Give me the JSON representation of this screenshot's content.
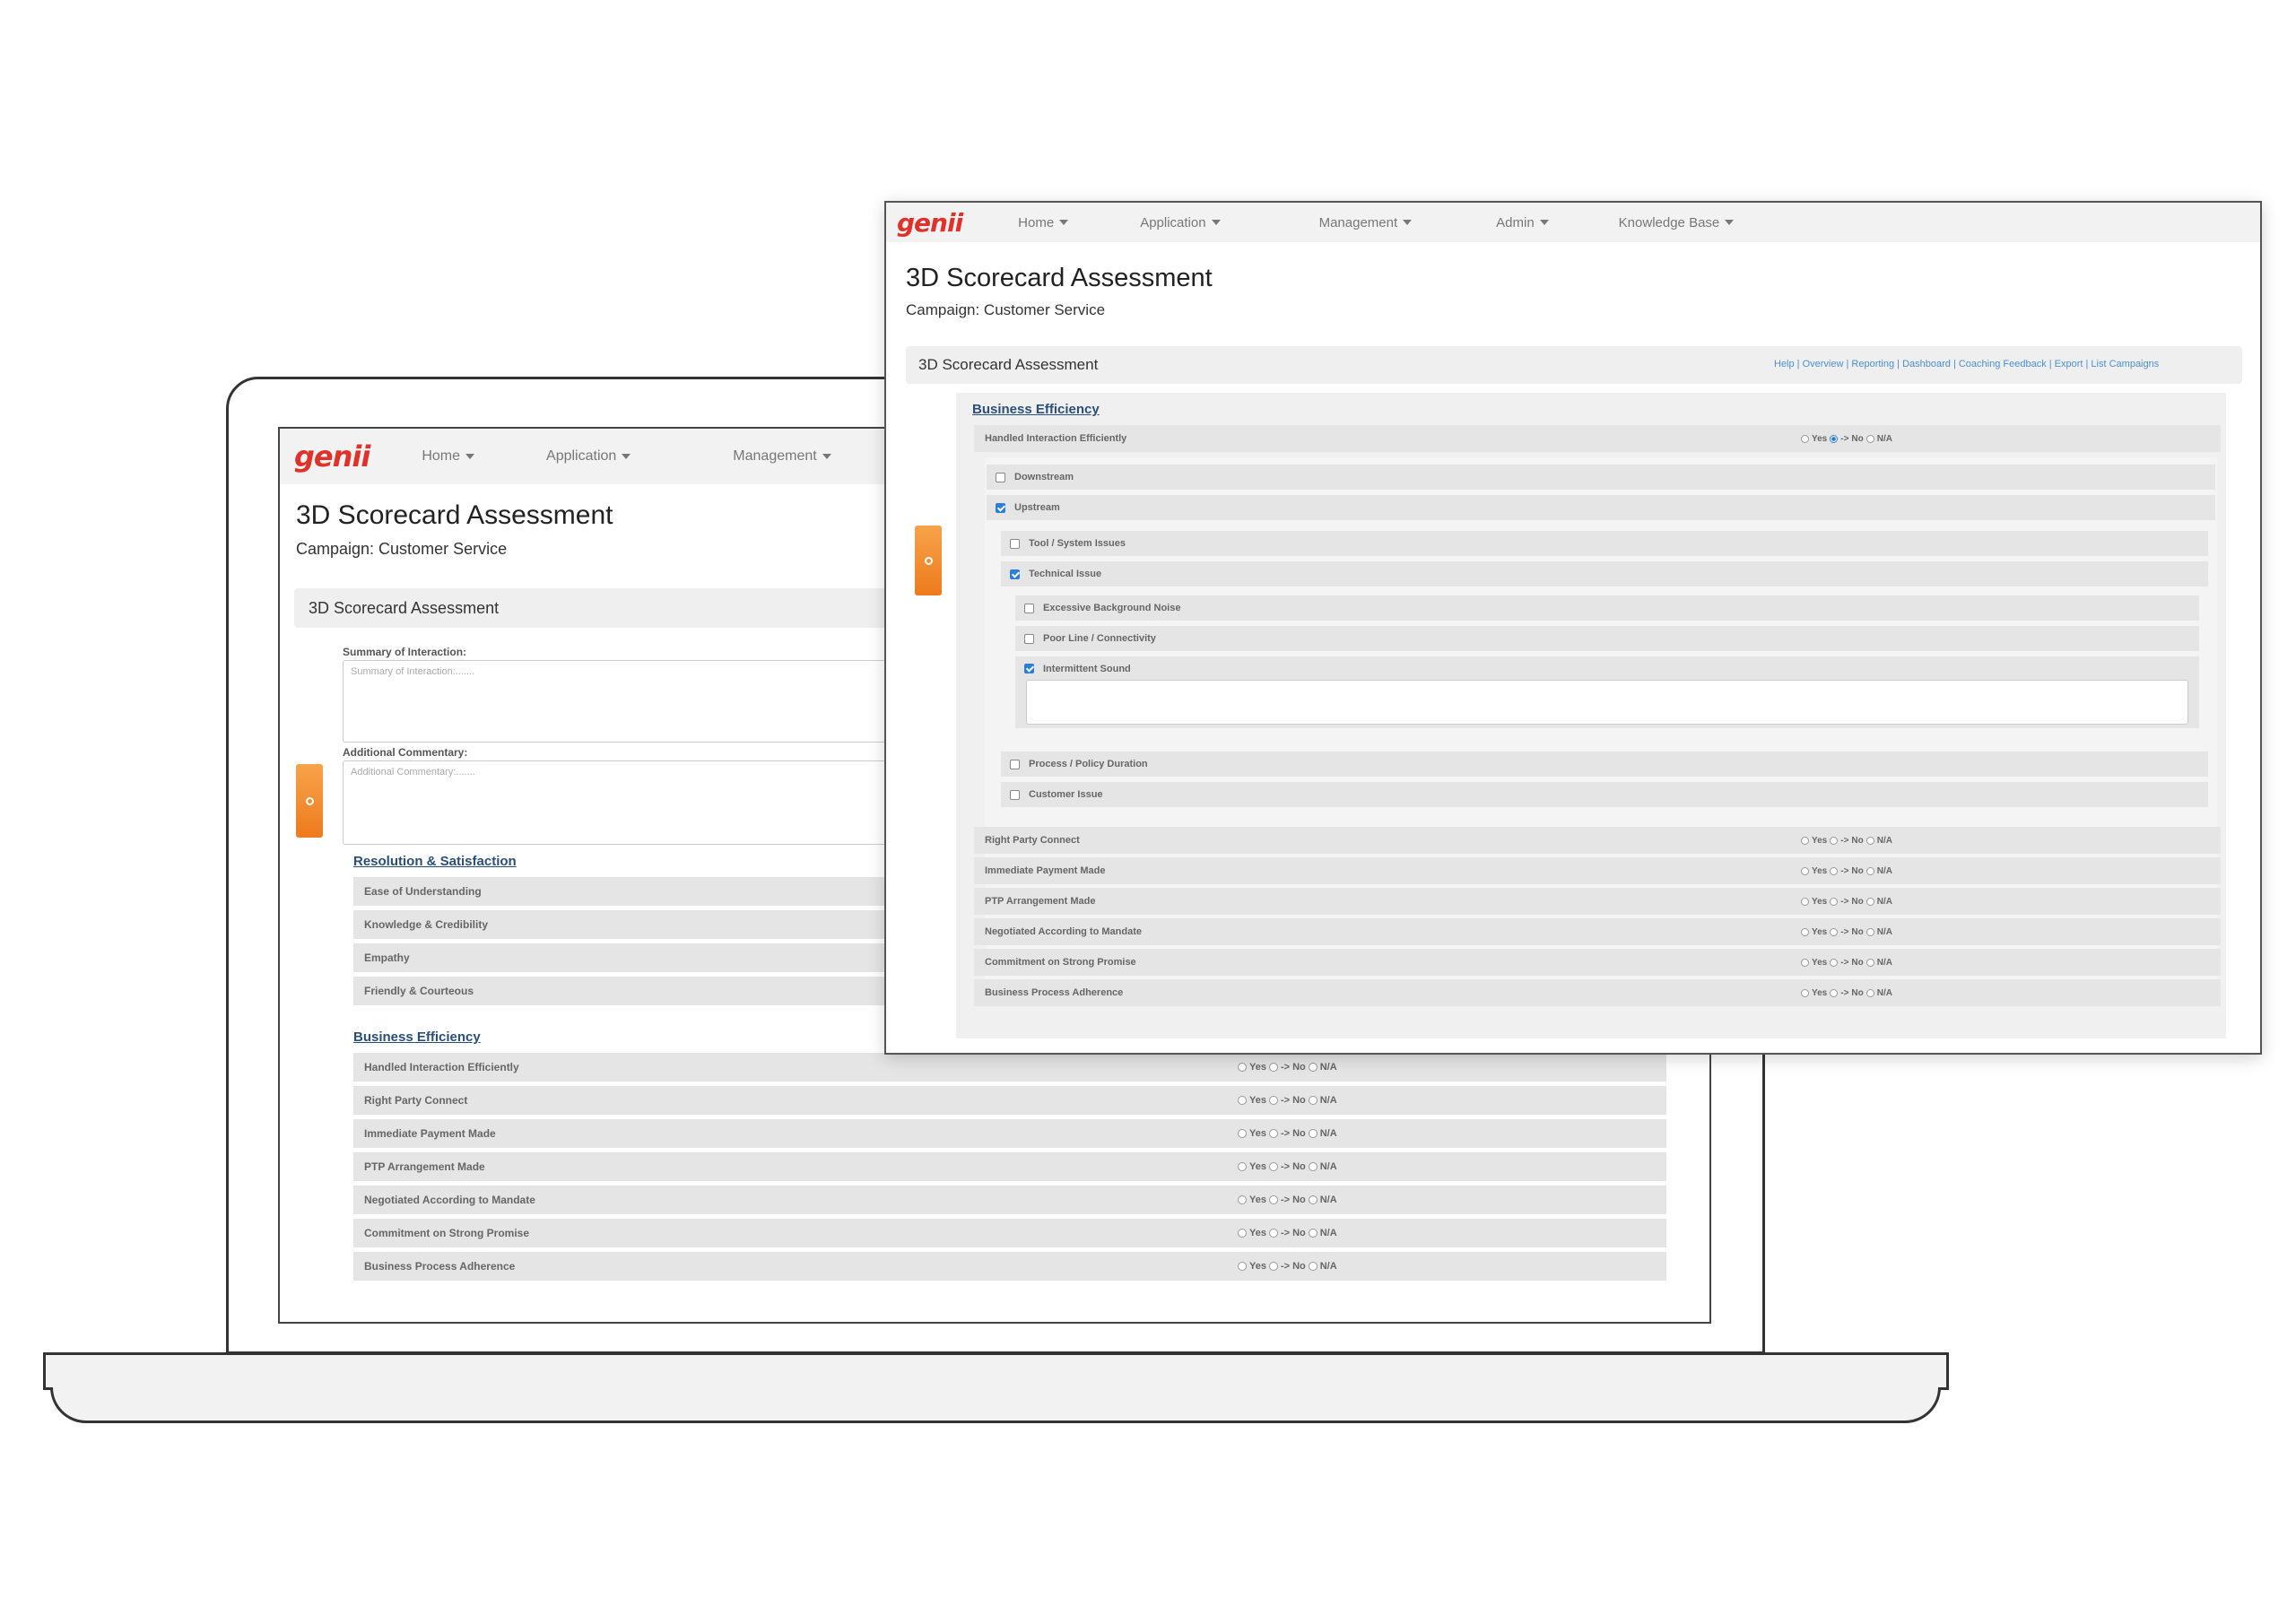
{
  "brand": {
    "logo_text": "genii",
    "accent_color": "#e0322b",
    "tab_color": "#ee7a1d"
  },
  "nav": {
    "home": "Home",
    "application": "Application",
    "management": "Management",
    "admin": "Admin",
    "knowledge_base": "Knowledge Base"
  },
  "page": {
    "title": "3D Scorecard Assessment",
    "campaign": "Campaign: Customer Service",
    "panel_title": "3D Scorecard Assessment"
  },
  "links": {
    "text": "Help | Overview | Reporting | Dashboard | Coaching Feedback | Export | List Campaigns"
  },
  "radio_labels": {
    "yes": "Yes",
    "no": "No",
    "na": "N/A",
    "arrow": "->"
  },
  "laptop": {
    "summary_label": "Summary of Interaction:",
    "summary_placeholder": "Summary of Interaction:.......",
    "commentary_label": "Additional Commentary:",
    "commentary_placeholder": "Additional Commentary:.......",
    "section_resolution": "Resolution & Satisfaction",
    "resolution_rows": [
      "Ease of Understanding",
      "Knowledge & Credibility",
      "Empathy",
      "Friendly & Courteous"
    ],
    "section_business": "Business Efficiency",
    "business_rows": [
      "Handled Interaction Efficiently",
      "Right Party Connect",
      "Immediate Payment Made",
      "PTP Arrangement Made",
      "Negotiated According to Mandate",
      "Commitment on Strong Promise",
      "Business Process Adherence"
    ]
  },
  "window": {
    "section_business": "Business Efficiency",
    "handled": "Handled Interaction Efficiently",
    "downstream": "Downstream",
    "upstream": "Upstream",
    "tool_system": "Tool / System Issues",
    "technical": "Technical Issue",
    "excessive_noise": "Excessive Background Noise",
    "poor_line": "Poor Line / Connectivity",
    "intermittent": "Intermittent Sound",
    "process_policy": "Process / Policy Duration",
    "customer_issue": "Customer Issue",
    "other_rows": [
      "Right Party Connect",
      "Immediate Payment Made",
      "PTP Arrangement Made",
      "Negotiated According to Mandate",
      "Commitment on Strong Promise",
      "Business Process Adherence"
    ]
  }
}
